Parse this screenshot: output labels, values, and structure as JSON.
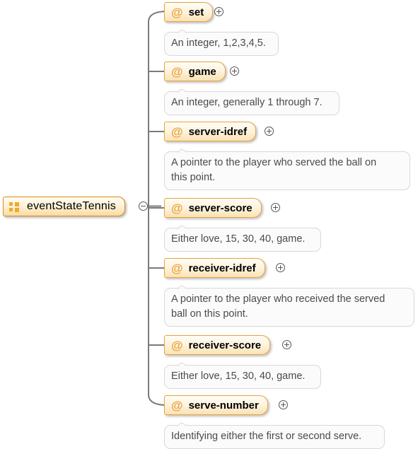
{
  "diagram": {
    "type": "xml-schema-attribute-tree",
    "root": {
      "label": "eventStateTennis",
      "icon": "sequence-icon",
      "collapse_control": "minus-circle-icon"
    },
    "colors": {
      "node_border": "#e8a33d",
      "node_fill_top": "#fffdf6",
      "node_fill_bottom": "#fae2b4",
      "at_sign": "#e8a33d",
      "connector": "#7a7a7a",
      "doc_border": "#d8d8d8",
      "doc_fill": "#fbfbfb",
      "doc_text": "#4a4a4a"
    },
    "attributes": [
      {
        "at": "@",
        "name": "set",
        "expand_control": "plus-circle-icon",
        "doc_lines": [
          "An integer, 1,2,3,4,5."
        ]
      },
      {
        "at": "@",
        "name": "game",
        "expand_control": "plus-circle-icon",
        "doc_lines": [
          "An integer, generally 1 through 7."
        ]
      },
      {
        "at": "@",
        "name": "server-idref",
        "expand_control": "plus-circle-icon",
        "doc_lines": [
          "A pointer to the player who served the ball on",
          "this point."
        ]
      },
      {
        "at": "@",
        "name": "server-score",
        "expand_control": "plus-circle-icon",
        "doc_lines": [
          "Either love, 15, 30, 40, game."
        ]
      },
      {
        "at": "@",
        "name": "receiver-idref",
        "expand_control": "plus-circle-icon",
        "doc_lines": [
          "A pointer to the player who received the served",
          "ball on this point."
        ]
      },
      {
        "at": "@",
        "name": "receiver-score",
        "expand_control": "plus-circle-icon",
        "doc_lines": [
          "Either love, 15, 30, 40, game."
        ]
      },
      {
        "at": "@",
        "name": "serve-number",
        "expand_control": "plus-circle-icon",
        "doc_lines": [
          "Identifying either the first or second serve."
        ]
      }
    ]
  }
}
